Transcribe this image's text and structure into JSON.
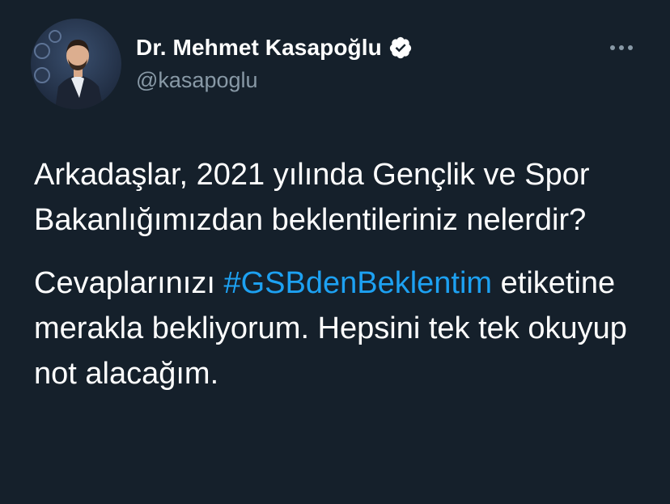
{
  "author": {
    "display_name": "Dr. Mehmet Kasapoğlu",
    "handle": "@kasapoglu",
    "verified": true
  },
  "tweet": {
    "paragraph1": "Arkadaşlar, 2021 yılında Gençlik ve Spor Bakanlığımızdan beklentileriniz nelerdir?",
    "paragraph2_before": "Cevaplarınızı ",
    "hashtag": "#GSBdenBeklentim",
    "paragraph2_after": " etiketine merakla bekliyorum. Hepsini tek tek okuyup not alacağım."
  },
  "icons": {
    "verified": "verified-badge-icon",
    "more": "more-horizontal-icon"
  },
  "colors": {
    "background": "#15202b",
    "text": "#ffffff",
    "secondary_text": "#8899a6",
    "link": "#1da1f2"
  }
}
